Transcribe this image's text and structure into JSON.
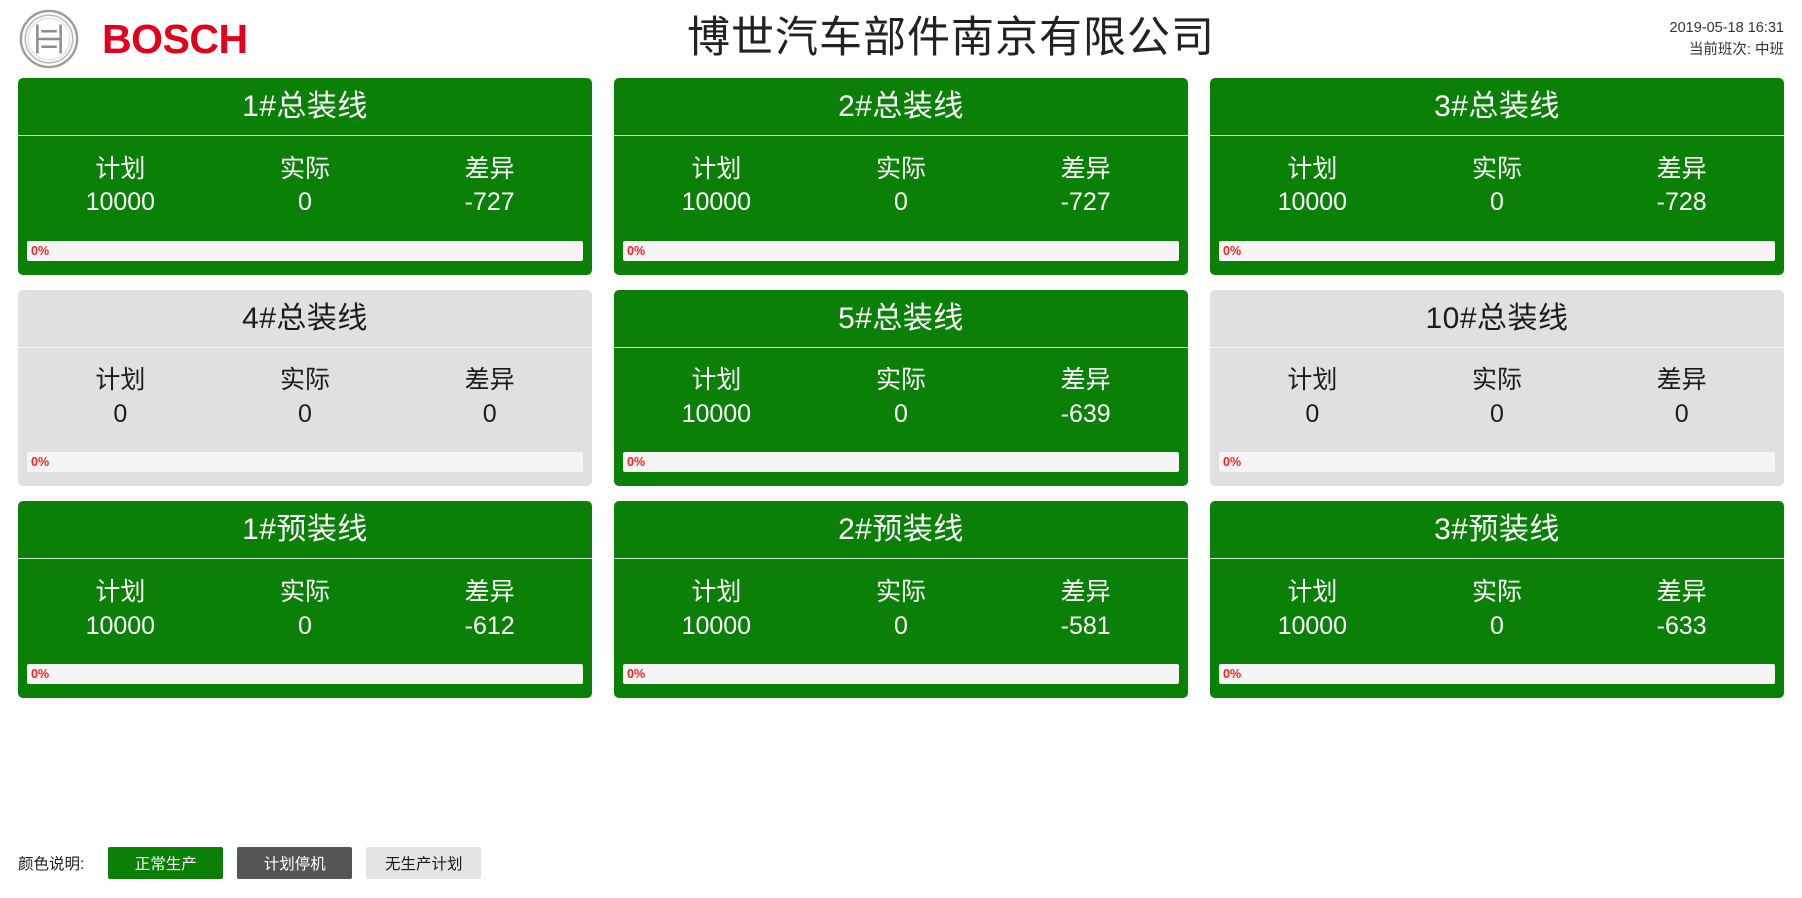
{
  "header": {
    "logo_icon": "bosch-logo-icon",
    "brand_text": "BOSCH",
    "title": "博世汽车部件南京有限公司",
    "datetime": "2019-05-18 16:31",
    "shift": "当前班次: 中班"
  },
  "columns": {
    "plan": "计划",
    "actual": "实际",
    "diff": "差异"
  },
  "colors": {
    "green": "#0a8006",
    "gray": "#e0e0e0",
    "dark_gray": "#555555",
    "progress_text": "#ff2020",
    "progress_track": "#f5f5f5",
    "brand_red": "#e2001a"
  },
  "cards": [
    {
      "title": "1#总装线",
      "status": "green",
      "plan": "10000",
      "actual": "0",
      "diff": "-727",
      "progress_label": "0%",
      "progress_pct": 0
    },
    {
      "title": "2#总装线",
      "status": "green",
      "plan": "10000",
      "actual": "0",
      "diff": "-727",
      "progress_label": "0%",
      "progress_pct": 0
    },
    {
      "title": "3#总装线",
      "status": "green",
      "plan": "10000",
      "actual": "0",
      "diff": "-728",
      "progress_label": "0%",
      "progress_pct": 0
    },
    {
      "title": "4#总装线",
      "status": "gray",
      "plan": "0",
      "actual": "0",
      "diff": "0",
      "progress_label": "0%",
      "progress_pct": 0
    },
    {
      "title": "5#总装线",
      "status": "green",
      "plan": "10000",
      "actual": "0",
      "diff": "-639",
      "progress_label": "0%",
      "progress_pct": 0
    },
    {
      "title": "10#总装线",
      "status": "gray",
      "plan": "0",
      "actual": "0",
      "diff": "0",
      "progress_label": "0%",
      "progress_pct": 0
    },
    {
      "title": "1#预装线",
      "status": "green",
      "plan": "10000",
      "actual": "0",
      "diff": "-612",
      "progress_label": "0%",
      "progress_pct": 0
    },
    {
      "title": "2#预装线",
      "status": "green",
      "plan": "10000",
      "actual": "0",
      "diff": "-581",
      "progress_label": "0%",
      "progress_pct": 0
    },
    {
      "title": "3#预装线",
      "status": "green",
      "plan": "10000",
      "actual": "0",
      "diff": "-633",
      "progress_label": "0%",
      "progress_pct": 0
    }
  ],
  "legend": {
    "caption": "颜色说明:",
    "items": [
      {
        "label": "正常生产",
        "kind": "normal"
      },
      {
        "label": "计划停机",
        "kind": "planned"
      },
      {
        "label": "无生产计划",
        "kind": "noplan"
      }
    ]
  }
}
